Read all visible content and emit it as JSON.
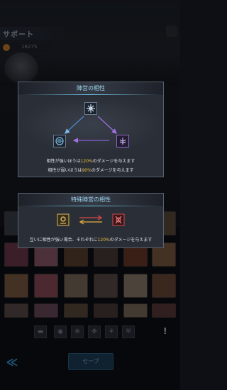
{
  "header": {
    "title": "サポート",
    "power_value": "18275"
  },
  "faction_panel": {
    "title": "陣営の相性",
    "line1_pre": "相性が強いほうは",
    "line1_pct": "120%",
    "line1_post": "のダメージを与えます",
    "line2_pre": "相性が弱いほうは",
    "line2_pct": "90%",
    "line2_post": "のダメージを与えます"
  },
  "special_panel": {
    "title": "特殊陣営の相性",
    "line_pre": "互いに相性が強い場合、それぞれに",
    "line_pct": "120%",
    "line_post": "のダメージを与えます"
  },
  "footer": {
    "save_label": "セーブ",
    "back_icon": "≪",
    "alert_icon": "!"
  },
  "colors": {
    "accent_blue": "#6fc6ea",
    "highlight": "#f0c040",
    "arrow_purple": "#8a5cd6",
    "arrow_red": "#d94a4a"
  }
}
